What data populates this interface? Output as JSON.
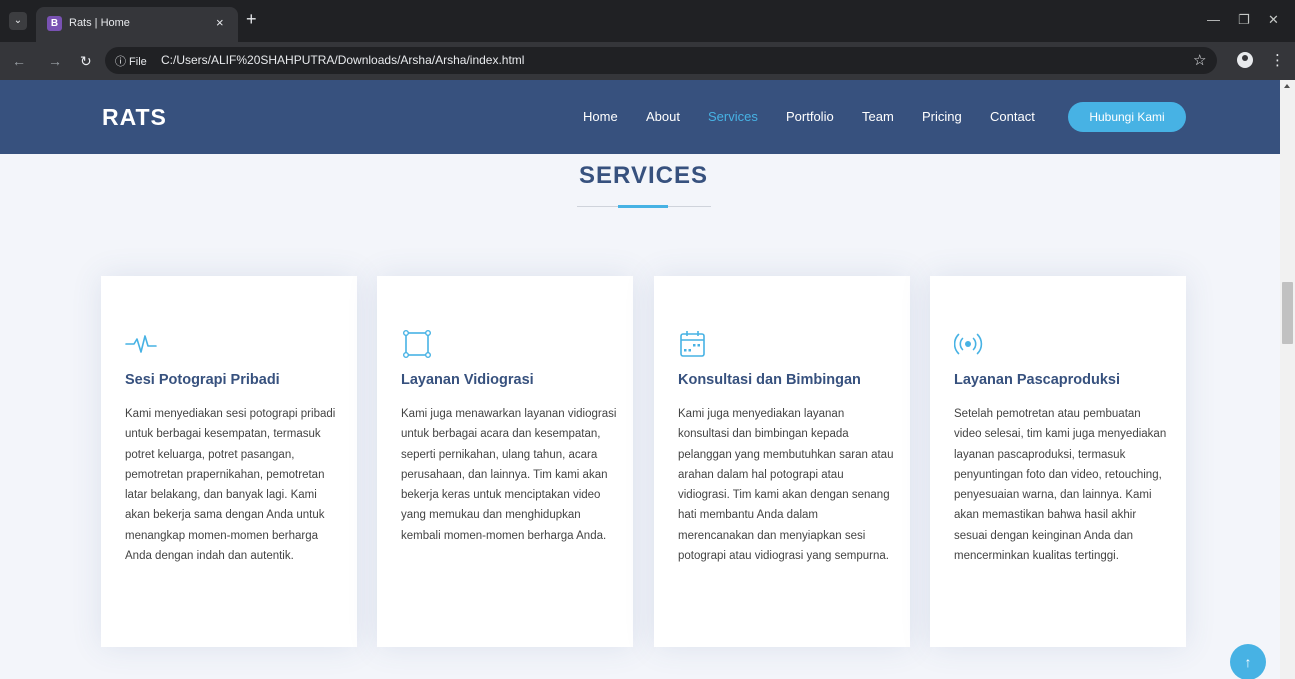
{
  "browser": {
    "tab_favicon": "B",
    "tab_title": "Rats | Home",
    "tab_close": "×",
    "new_tab": "+",
    "info_chip": "ⓘ File",
    "url": "C:/Users/ALIF%20SHAHPUTRA/Downloads/Arsha/Arsha/index.html",
    "icons": [
      "chevron-down-icon",
      "back-icon",
      "forward-icon",
      "reload-icon",
      "star-icon",
      "profile-icon",
      "kebab-icon",
      "minimize-icon",
      "restore-icon",
      "close-icon"
    ]
  },
  "site": {
    "logo": "RATS",
    "nav": [
      "Home",
      "About",
      "Services",
      "Portfolio",
      "Team",
      "Pricing",
      "Contact"
    ],
    "active_nav": "Services",
    "cta": "Hubungi Kami"
  },
  "services": {
    "title": "SERVICES",
    "cards": [
      {
        "icon": "activity-icon",
        "title": "Sesi Potograpi Pribadi",
        "text": "Kami menyediakan sesi potograpi pribadi untuk berbagai kesempatan, termasuk potret keluarga, potret pasangan, pemotretan prapernikahan, pemotretan latar belakang, dan banyak lagi. Kami akan bekerja sama dengan Anda untuk menangkap momen-momen berharga Anda dengan indah dan autentik."
      },
      {
        "icon": "bounding-box-icon",
        "title": "Layanan Vidiograsi",
        "text": "Kami juga menawarkan layanan vidiograsi untuk berbagai acara dan kesempatan, seperti pernikahan, ulang tahun, acara perusahaan, dan lainnya. Tim kami akan bekerja keras untuk menciptakan video yang memukau dan menghidupkan kembali momen-momen berharga Anda."
      },
      {
        "icon": "calendar-icon",
        "title": "Konsultasi dan Bimbingan",
        "text": "Kami juga menyediakan layanan konsultasi dan bimbingan kepada pelanggan yang membutuhkan saran atau arahan dalam hal potograpi atau vidiograsi. Tim kami akan dengan senang hati membantu Anda dalam merencanakan dan menyiapkan sesi potograpi atau vidiograsi yang sempurna."
      },
      {
        "icon": "broadcast-icon",
        "title": "Layanan Pascaproduksi",
        "text": "Setelah pemotretan atau pembuatan video selesai, tim kami juga menyediakan layanan pascaproduksi, termasuk penyuntingan foto dan video, retouching, penyesuaian warna, dan lainnya. Kami akan memastikan bahwa hasil akhir sesuai dengan keinginan Anda dan mencerminkan kualitas tertinggi."
      }
    ]
  },
  "back_to_top": "↑",
  "colors": {
    "header_bg": "#37517e",
    "accent": "#47b2e4",
    "section_bg": "#f3f5fa",
    "heading": "#37517e",
    "body_text": "#444444"
  }
}
